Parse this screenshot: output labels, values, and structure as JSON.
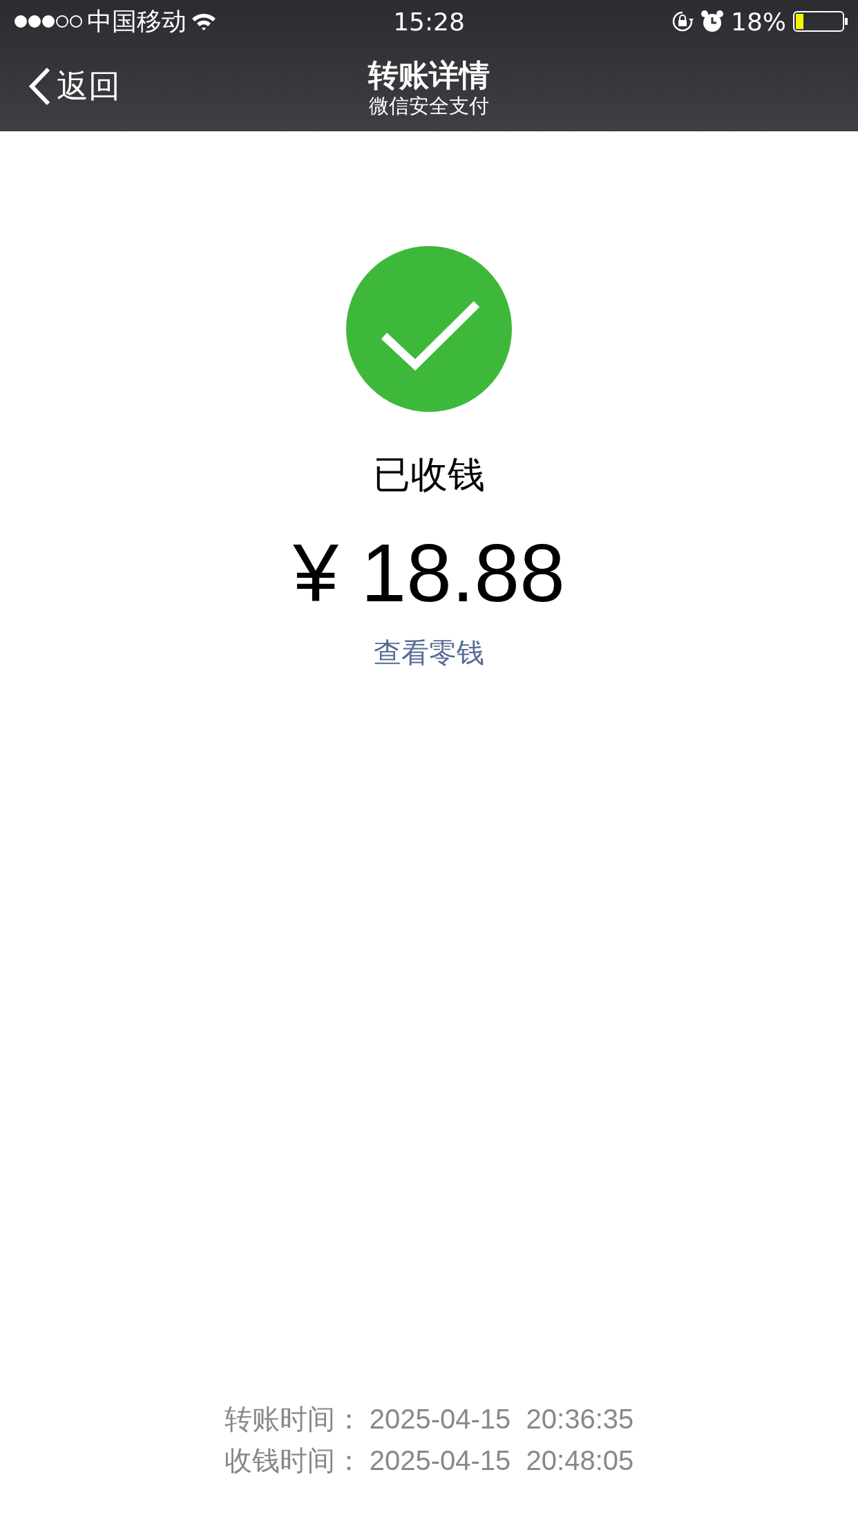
{
  "status_bar": {
    "carrier": "中国移动",
    "time": "15:28",
    "battery": "18%"
  },
  "nav": {
    "back": "返回",
    "title": "转账详情",
    "subtitle": "微信安全支付"
  },
  "result": {
    "status": "已收钱",
    "amount": "¥ 18.88",
    "link": "查看零钱"
  },
  "details": [
    {
      "label": "转账时间：",
      "value": "2025-04-15  20:36:35"
    },
    {
      "label": "收钱时间：",
      "value": "2025-04-15  20:48:05"
    }
  ]
}
